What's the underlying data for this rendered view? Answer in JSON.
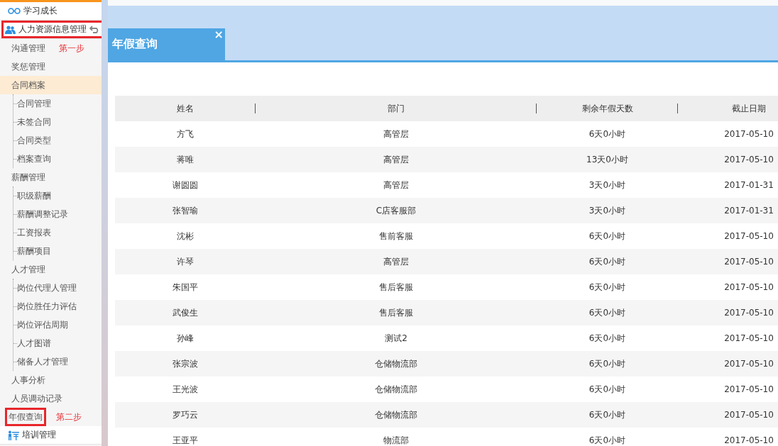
{
  "sidebar": {
    "items": [
      {
        "label": "学习成长",
        "kind": "section",
        "selected": false,
        "boxed": false
      },
      {
        "label": "人力资源信息管理",
        "kind": "section",
        "selected": false,
        "boxed": true,
        "back": true
      },
      {
        "label": "沟通管理",
        "kind": "item",
        "selected": false,
        "boxed": false,
        "note": "第一步"
      },
      {
        "label": "奖惩管理",
        "kind": "item",
        "selected": false,
        "boxed": false
      },
      {
        "label": "合同档案",
        "kind": "item",
        "selected": true,
        "boxed": false,
        "children": [
          {
            "label": "合同管理"
          },
          {
            "label": "未签合同"
          },
          {
            "label": "合同类型"
          },
          {
            "label": "档案查询"
          }
        ]
      },
      {
        "label": "薪酬管理",
        "kind": "item",
        "selected": false,
        "boxed": false,
        "children": [
          {
            "label": "职级薪酬"
          },
          {
            "label": "薪酬调整记录"
          },
          {
            "label": "工资报表"
          },
          {
            "label": "薪酬项目"
          }
        ]
      },
      {
        "label": "人才管理",
        "kind": "item",
        "selected": false,
        "boxed": false,
        "children": [
          {
            "label": "岗位代理人管理"
          },
          {
            "label": "岗位胜任力评估"
          },
          {
            "label": "岗位评估周期"
          },
          {
            "label": "人才图谱"
          },
          {
            "label": "储备人才管理"
          }
        ]
      },
      {
        "label": "人事分析",
        "kind": "item",
        "selected": false,
        "boxed": false
      },
      {
        "label": "人员调动记录",
        "kind": "item",
        "selected": false,
        "boxed": false
      },
      {
        "label": "年假查询",
        "kind": "item",
        "selected": false,
        "boxed": true,
        "note": "第二步"
      },
      {
        "label": "培训管理",
        "kind": "section",
        "selected": false,
        "boxed": false
      }
    ]
  },
  "tabs": [
    {
      "label": "年假查询",
      "selected": true,
      "close": "×"
    }
  ],
  "table": {
    "columns": [
      "姓名",
      "部门",
      "剩余年假天数",
      "截止日期"
    ],
    "rows": [
      [
        "方飞",
        "高管层",
        "6天0小时",
        "2017-05-10"
      ],
      [
        "蒋唯",
        "高管层",
        "13天0小时",
        "2017-05-10"
      ],
      [
        "谢圆圆",
        "高管层",
        "3天0小时",
        "2017-01-31"
      ],
      [
        "张智瑜",
        "C店客服部",
        "3天0小时",
        "2017-01-31"
      ],
      [
        "沈彬",
        "售前客服",
        "6天0小时",
        "2017-05-10"
      ],
      [
        "许琴",
        "高管层",
        "6天0小时",
        "2017-05-10"
      ],
      [
        "朱国平",
        "售后客服",
        "6天0小时",
        "2017-05-10"
      ],
      [
        "武俊生",
        "售后客服",
        "6天0小时",
        "2017-05-10"
      ],
      [
        "孙峰",
        "测试2",
        "6天0小时",
        "2017-05-10"
      ],
      [
        "张宗波",
        "仓储物流部",
        "6天0小时",
        "2017-05-10"
      ],
      [
        "王光波",
        "仓储物流部",
        "6天0小时",
        "2017-05-10"
      ],
      [
        "罗巧云",
        "仓储物流部",
        "6天0小时",
        "2017-05-10"
      ],
      [
        "王亚平",
        "物流部",
        "6天0小时",
        "2017-05-10"
      ]
    ]
  }
}
